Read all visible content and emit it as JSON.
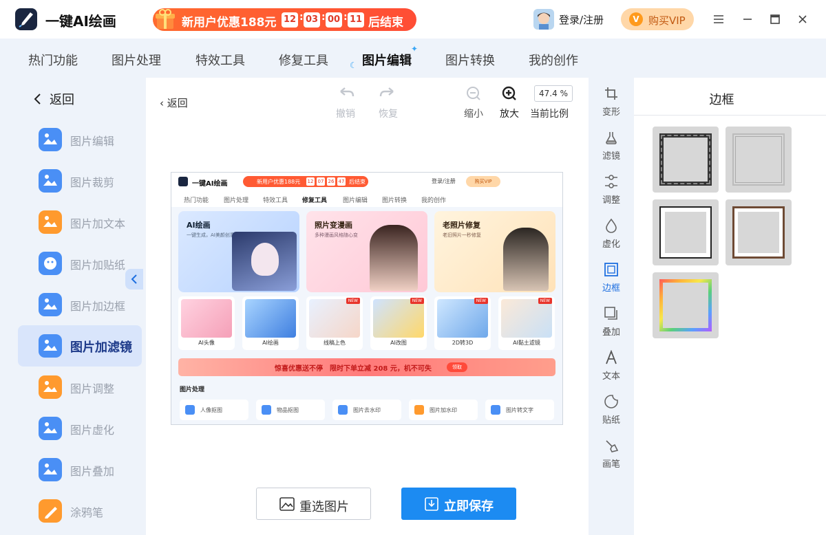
{
  "app": {
    "title": "一键AI绘画",
    "promo_text": "新用户优惠188元",
    "countdown": [
      "12",
      "03",
      "00",
      "11"
    ],
    "promo_end": "后结束",
    "login": "登录/注册",
    "vip": "购买VIP",
    "vip_badge": "V"
  },
  "nav": {
    "tabs": [
      "热门功能",
      "图片处理",
      "特效工具",
      "修复工具",
      "图片编辑",
      "图片转换",
      "我的创作"
    ],
    "active": "图片编辑"
  },
  "sidebar": {
    "back": "返回",
    "items": [
      {
        "label": "图片编辑",
        "color": "#4a8ff5"
      },
      {
        "label": "图片裁剪",
        "color": "#4a8ff5"
      },
      {
        "label": "图片加文本",
        "color": "#ff9a2e"
      },
      {
        "label": "图片加贴纸",
        "color": "#4a8ff5"
      },
      {
        "label": "图片加边框",
        "color": "#4a8ff5"
      },
      {
        "label": "图片加滤镜",
        "color": "#4a8ff5"
      },
      {
        "label": "图片调整",
        "color": "#ff9a2e"
      },
      {
        "label": "图片虚化",
        "color": "#4a8ff5"
      },
      {
        "label": "图片叠加",
        "color": "#4a8ff5"
      },
      {
        "label": "涂鸦笔",
        "color": "#ff9a2e"
      }
    ],
    "active_index": 5
  },
  "editor": {
    "back": "返回",
    "undo": "撤销",
    "redo": "恢复",
    "zoom_out": "缩小",
    "zoom_in": "放大",
    "ratio_value": "47.4 %",
    "ratio_label": "当前比例",
    "reselect": "重选图片",
    "save": "立即保存"
  },
  "preview": {
    "title": "一键AI绘画",
    "promo": "新用户优惠188元",
    "countdown": [
      "12",
      "07",
      "26",
      "47"
    ],
    "promo_end": "后结束",
    "login": "登录/注册",
    "vip": "购买VIP",
    "tabs": [
      "热门功能",
      "图片处理",
      "特效工具",
      "修复工具",
      "图片编辑",
      "图片转换",
      "我的创作"
    ],
    "cards": [
      {
        "title": "AI绘画",
        "sub": "一键生成，AI美颜创意"
      },
      {
        "title": "照片变漫画",
        "sub": "多种漫画风格随心变"
      },
      {
        "title": "老照片修复",
        "sub": "老旧照片一秒修复"
      }
    ],
    "small": [
      {
        "label": "AI头像",
        "new": ""
      },
      {
        "label": "AI绘画",
        "new": ""
      },
      {
        "label": "线稿上色",
        "new": "NEW"
      },
      {
        "label": "AI改图",
        "new": "NEW"
      },
      {
        "label": "2D转3D",
        "new": "NEW"
      },
      {
        "label": "AI黏土滤镜",
        "new": "NEW"
      }
    ],
    "banner": "惊喜优惠送不停　限时下单立减 208 元，机不可失",
    "banner_btn": "领取",
    "section": "图片处理",
    "tools": [
      "人像抠图",
      "物品抠图",
      "图片去水印",
      "图片加水印",
      "图片转文字"
    ]
  },
  "tools": {
    "items": [
      "变形",
      "滤镜",
      "调整",
      "虚化",
      "边框",
      "叠加",
      "文本",
      "贴纸",
      "画笔"
    ],
    "active": "边框"
  },
  "panel": {
    "title": "边框"
  }
}
